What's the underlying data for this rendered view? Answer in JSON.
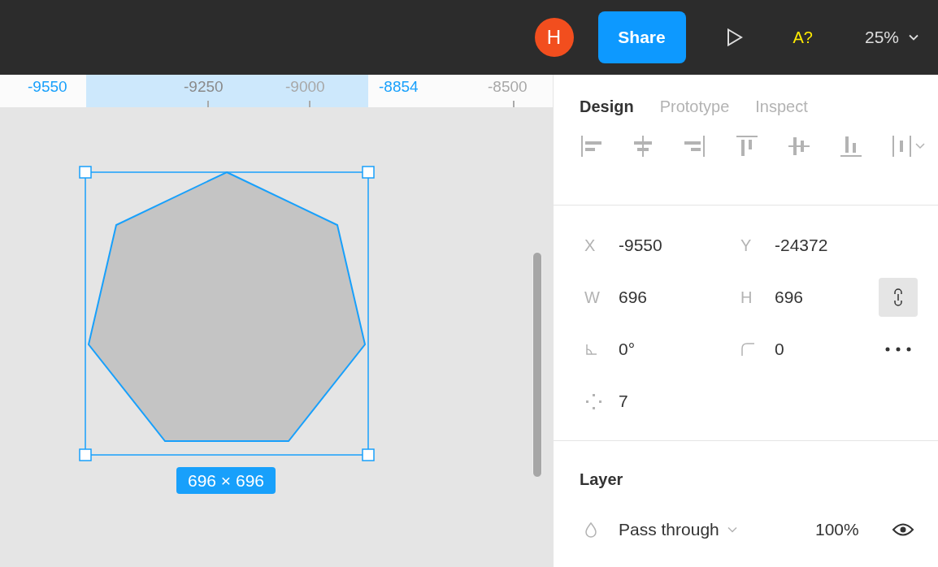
{
  "topbar": {
    "avatar": {
      "initial": "H",
      "color": "#f24e1e"
    },
    "share_button": "Share",
    "accessibility_check": "A?",
    "zoom": "25%"
  },
  "ruler": {
    "labels": [
      {
        "text": "-9550",
        "kind": "bound"
      },
      {
        "text": "-9250",
        "kind": "tick"
      },
      {
        "text": "-9000",
        "kind": "dim"
      },
      {
        "text": "-8854",
        "kind": "bound"
      },
      {
        "text": "-8500",
        "kind": "dim"
      }
    ]
  },
  "canvas": {
    "dimension_label": "696 × 696"
  },
  "panel": {
    "tabs": [
      {
        "label": "Design",
        "selected": true
      },
      {
        "label": "Prototype",
        "selected": false
      },
      {
        "label": "Inspect",
        "selected": false
      }
    ],
    "properties": [
      {
        "kind": "letter",
        "label": "X",
        "value": "-9550"
      },
      {
        "kind": "letter",
        "label": "Y",
        "value": "-24372"
      },
      {
        "kind": "letter",
        "label": "W",
        "value": "696"
      },
      {
        "kind": "letter",
        "label": "H",
        "value": "696"
      },
      {
        "kind": "rotation",
        "value": "0°"
      },
      {
        "kind": "radius",
        "value": "0"
      },
      {
        "kind": "count",
        "value": "7"
      }
    ],
    "constrain_proportions": {
      "on": true
    },
    "layer": {
      "title": "Layer",
      "blend_mode": "Pass through",
      "opacity": "100%",
      "visible": true
    }
  }
}
